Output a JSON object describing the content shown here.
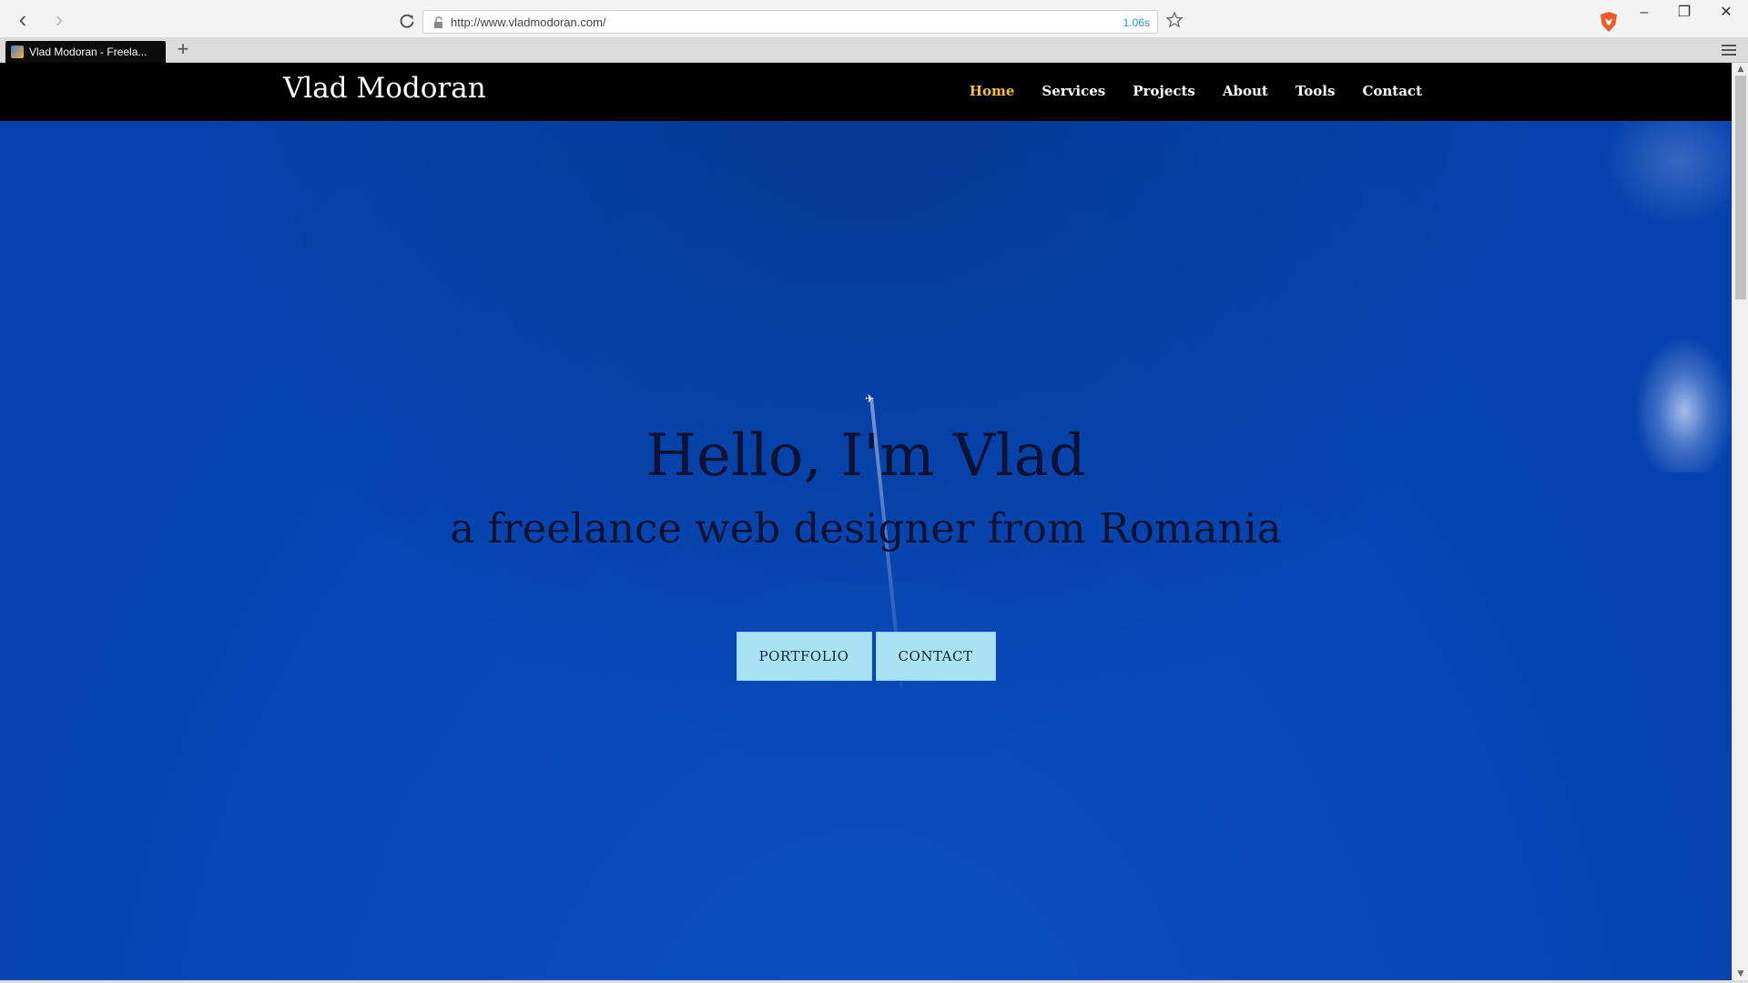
{
  "browser": {
    "url": "http://www.vladmodoran.com/",
    "load_time": "1.06s",
    "tab_title": "Vlad Modoran - Freela..."
  },
  "site": {
    "brand": "Vlad Modoran",
    "nav": [
      "Home",
      "Services",
      "Projects",
      "About",
      "Tools",
      "Contact"
    ],
    "active_nav": "Home",
    "accent_color": "#f5c13b"
  },
  "hero": {
    "title": "Hello, I'm Vlad",
    "subtitle": "a freelance web designer from Romania",
    "buttons": {
      "portfolio": "PORTFOLIO",
      "contact": "CONTACT"
    }
  },
  "colors": {
    "sky": "#0848b8",
    "navbar": "#000000",
    "button_bg": "#a9e2f5"
  }
}
